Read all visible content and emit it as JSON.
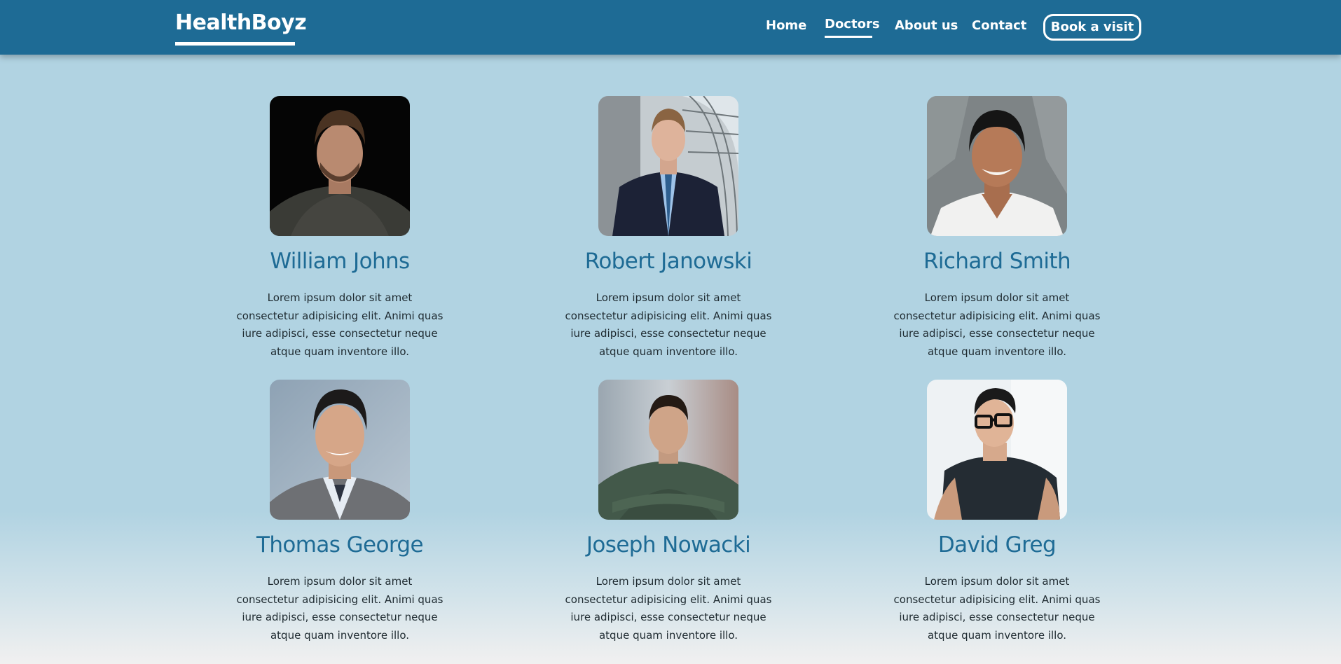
{
  "navbar": {
    "logo": "HealthBoyz",
    "links": [
      {
        "label": "Home"
      },
      {
        "label": "Doctors",
        "active": true
      },
      {
        "label": "About us"
      },
      {
        "label": "Contact"
      }
    ],
    "cta_label": "Book a visit"
  },
  "colors": {
    "brand": "#1e6b95",
    "background": "#b1d3e2",
    "text": "#1e2a30"
  },
  "doctors": [
    {
      "name": "William Johns",
      "description": "Lorem ipsum dolor sit amet consectetur adipisicing elit. Animi quas iure adipisci, esse consectetur neque atque quam inventore illo.",
      "photo": "portrait-photo"
    },
    {
      "name": "Robert Janowski",
      "description": "Lorem ipsum dolor sit amet consectetur adipisicing elit. Animi quas iure adipisci, esse consectetur neque atque quam inventore illo.",
      "photo": "portrait-photo"
    },
    {
      "name": "Richard Smith",
      "description": "Lorem ipsum dolor sit amet consectetur adipisicing elit. Animi quas iure adipisci, esse consectetur neque atque quam inventore illo.",
      "photo": "portrait-photo"
    },
    {
      "name": "Thomas George",
      "description": "Lorem ipsum dolor sit amet consectetur adipisicing elit. Animi quas iure adipisci, esse consectetur neque atque quam inventore illo.",
      "photo": "portrait-photo"
    },
    {
      "name": "Joseph Nowacki",
      "description": "Lorem ipsum dolor sit amet consectetur adipisicing elit. Animi quas iure adipisci, esse consectetur neque atque quam inventore illo.",
      "photo": "portrait-photo"
    },
    {
      "name": "David Greg",
      "description": "Lorem ipsum dolor sit amet consectetur adipisicing elit. Animi quas iure adipisci, esse consectetur neque atque quam inventore illo.",
      "photo": "portrait-photo"
    }
  ]
}
